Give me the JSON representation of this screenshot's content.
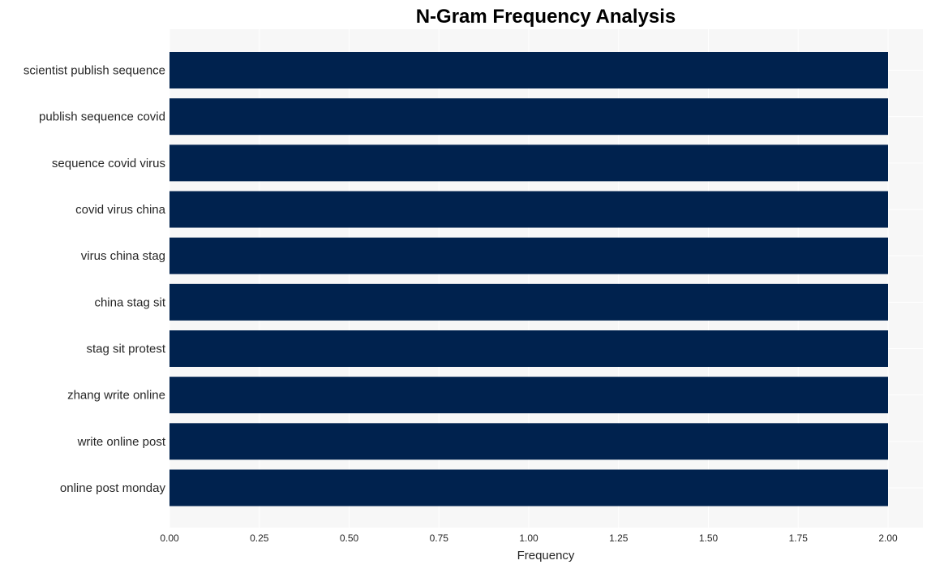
{
  "chart_data": {
    "type": "bar",
    "orientation": "horizontal",
    "title": "N-Gram Frequency Analysis",
    "xlabel": "Frequency",
    "ylabel": "",
    "categories": [
      "scientist publish sequence",
      "publish sequence covid",
      "sequence covid virus",
      "covid virus china",
      "virus china stag",
      "china stag sit",
      "stag sit protest",
      "zhang write online",
      "write online post",
      "online post monday"
    ],
    "values": [
      2,
      2,
      2,
      2,
      2,
      2,
      2,
      2,
      2,
      2
    ],
    "xlim": [
      0,
      2.1
    ],
    "xticks": [
      0,
      0.25,
      0.5,
      0.75,
      1.0,
      1.25,
      1.5,
      1.75,
      2.0
    ],
    "xtick_labels": [
      "0.00",
      "0.25",
      "0.50",
      "0.75",
      "1.00",
      "1.25",
      "1.50",
      "1.75",
      "2.00"
    ],
    "grid": true,
    "legend": "none",
    "colors": {
      "bar": "#00224e",
      "plot_background": "#f7f7f7",
      "grid": "#ffffff"
    }
  }
}
